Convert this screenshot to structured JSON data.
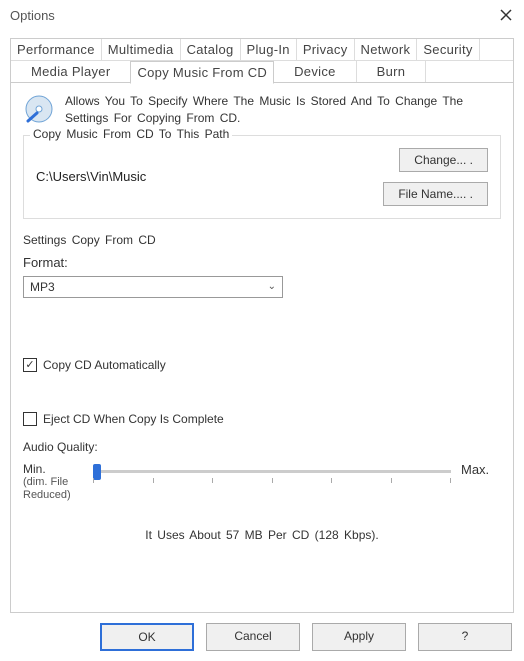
{
  "window": {
    "title": "Options"
  },
  "tabs_row1": {
    "t0": "Performance",
    "t1": "Multimedia",
    "t2": "Catalog",
    "t3": "Plug-In",
    "t4": "Privacy",
    "t5": "Network",
    "t6": "Security"
  },
  "tabs_row2": {
    "t0": "Media Player",
    "t1": "Copy Music From CD",
    "t2": "Device",
    "t3": "Burn"
  },
  "description": "Allows You To Specify Where The Music Is Stored And To Change The Settings For Copying From CD.",
  "group_path": {
    "title": "Copy Music From CD To This Path",
    "value": "C:\\Users\\Vin\\Music",
    "change_btn": "Change... .",
    "filename_btn": "File Name.... ."
  },
  "group_settings": {
    "title": "Settings Copy From CD",
    "format_label": "Format:",
    "format_value": "MP3",
    "copy_auto": "Copy CD Automatically",
    "copy_auto_checked": "✓",
    "eject": "Eject CD When Copy Is Complete",
    "quality_label": "Audio Quality:",
    "min_label": "Min.",
    "min_sub": "(dim. File Reduced)",
    "max_label": "Max.",
    "usage": "It Uses About 57 MB Per CD (128 Kbps)."
  },
  "footer": {
    "ok": "OK",
    "cancel": "Cancel",
    "apply": "Apply",
    "help": "?"
  }
}
